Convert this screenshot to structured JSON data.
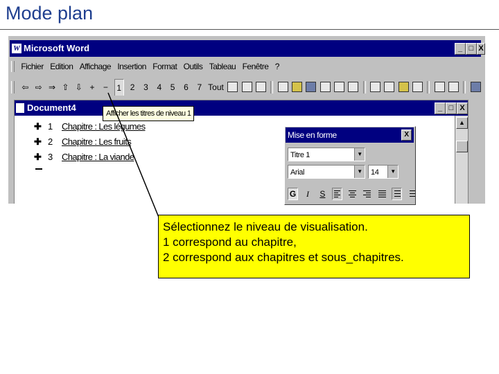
{
  "slide": {
    "title": "Mode plan"
  },
  "window": {
    "app_icon": "W",
    "title": "Microsoft Word",
    "buttons": [
      "_",
      "□",
      "X"
    ]
  },
  "menubar": {
    "items": [
      "Fichier",
      "Edition",
      "Affichage",
      "Insertion",
      "Format",
      "Outils",
      "Tableau",
      "Fenêtre",
      "?"
    ]
  },
  "toolbar": {
    "outline_buttons": [
      "⇦",
      "⇨",
      "⇒",
      "⇧",
      "⇩",
      "+",
      "−"
    ],
    "level_buttons": [
      "1",
      "2",
      "3",
      "4",
      "5",
      "6",
      "7",
      "Tout"
    ],
    "active_level": "1",
    "icons": [
      "promote-icon",
      "demote-icon",
      "move-up-icon",
      "move-down-icon",
      "expand-icon",
      "collapse-icon",
      "new-doc-icon",
      "open-icon",
      "save-icon",
      "print-icon",
      "preview-icon",
      "spelling-icon",
      "cut-icon",
      "copy-icon",
      "paste-icon",
      "undo-icon",
      "redo-icon",
      "table-icon",
      "columns-icon",
      "zoom-icon",
      "help-icon"
    ]
  },
  "tooltip": {
    "text": "Afficher les titres de niveau 1"
  },
  "document": {
    "title": "Document4",
    "buttons": [
      "_",
      "□",
      "X"
    ],
    "outline": [
      {
        "marker": "✚",
        "num": "1",
        "text": "Chapitre : Les légumes"
      },
      {
        "marker": "✚",
        "num": "2",
        "text": "Chapitre : Les fruits"
      },
      {
        "marker": "✚",
        "num": "3",
        "text": "Chapitre : La viande"
      }
    ]
  },
  "format_panel": {
    "title": "Mise en forme",
    "close": "X",
    "style": "Titre 1",
    "font": "Arial",
    "size": "14",
    "buttons": [
      "G",
      "I",
      "S"
    ]
  },
  "callout": {
    "lines": [
      "Sélectionnez le niveau de visualisation.",
      "1 correspond au chapitre,",
      "2 correspond aux chapitres et sous_chapitres."
    ]
  },
  "colors": {
    "title_text": "#1f3f8f",
    "titlebar": "#000080",
    "callout_bg": "#ffff00",
    "tooltip_bg": "#ffffe1"
  }
}
